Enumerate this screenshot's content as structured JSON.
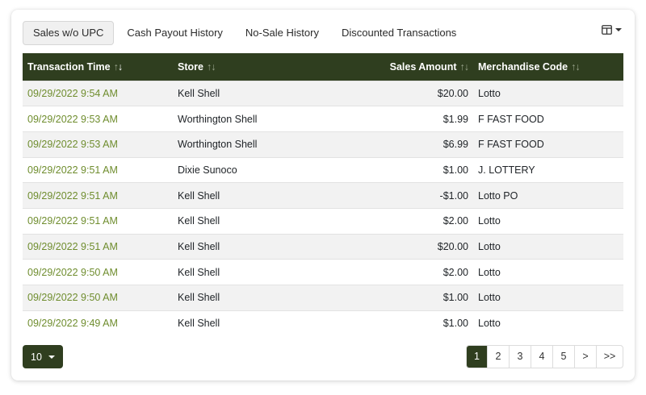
{
  "tabs": [
    {
      "label": "Sales w/o UPC",
      "active": true
    },
    {
      "label": "Cash Payout History",
      "active": false
    },
    {
      "label": "No-Sale History",
      "active": false
    },
    {
      "label": "Discounted Transactions",
      "active": false
    }
  ],
  "column_toggle": {
    "icon": "table-columns-icon"
  },
  "table": {
    "headers": [
      {
        "label": "Transaction Time",
        "sort": "↑↓",
        "sort_active": "down"
      },
      {
        "label": "Store",
        "sort": "↑↓",
        "sort_active": "none"
      },
      {
        "label": "Sales Amount",
        "sort": "↑↓",
        "sort_active": "none"
      },
      {
        "label": "Merchandise Code",
        "sort": "↑↓",
        "sort_active": "none"
      }
    ],
    "rows": [
      {
        "time": "09/29/2022 9:54 AM",
        "store": "Kell Shell",
        "amount": "$20.00",
        "code": "Lotto"
      },
      {
        "time": "09/29/2022 9:53 AM",
        "store": "Worthington Shell",
        "amount": "$1.99",
        "code": "F FAST FOOD"
      },
      {
        "time": "09/29/2022 9:53 AM",
        "store": "Worthington Shell",
        "amount": "$6.99",
        "code": "F FAST FOOD"
      },
      {
        "time": "09/29/2022 9:51 AM",
        "store": "Dixie Sunoco",
        "amount": "$1.00",
        "code": "J. LOTTERY"
      },
      {
        "time": "09/29/2022 9:51 AM",
        "store": "Kell Shell",
        "amount": "-$1.00",
        "code": "Lotto PO"
      },
      {
        "time": "09/29/2022 9:51 AM",
        "store": "Kell Shell",
        "amount": "$2.00",
        "code": "Lotto"
      },
      {
        "time": "09/29/2022 9:51 AM",
        "store": "Kell Shell",
        "amount": "$20.00",
        "code": "Lotto"
      },
      {
        "time": "09/29/2022 9:50 AM",
        "store": "Kell Shell",
        "amount": "$2.00",
        "code": "Lotto"
      },
      {
        "time": "09/29/2022 9:50 AM",
        "store": "Kell Shell",
        "amount": "$1.00",
        "code": "Lotto"
      },
      {
        "time": "09/29/2022 9:49 AM",
        "store": "Kell Shell",
        "amount": "$1.00",
        "code": "Lotto"
      }
    ]
  },
  "page_size": {
    "value": "10"
  },
  "pagination": {
    "pages": [
      "1",
      "2",
      "3",
      "4",
      "5",
      ">",
      ">>"
    ],
    "active": "1"
  },
  "colors": {
    "header_bg": "#2f3e1f",
    "link": "#6f8d2e"
  }
}
